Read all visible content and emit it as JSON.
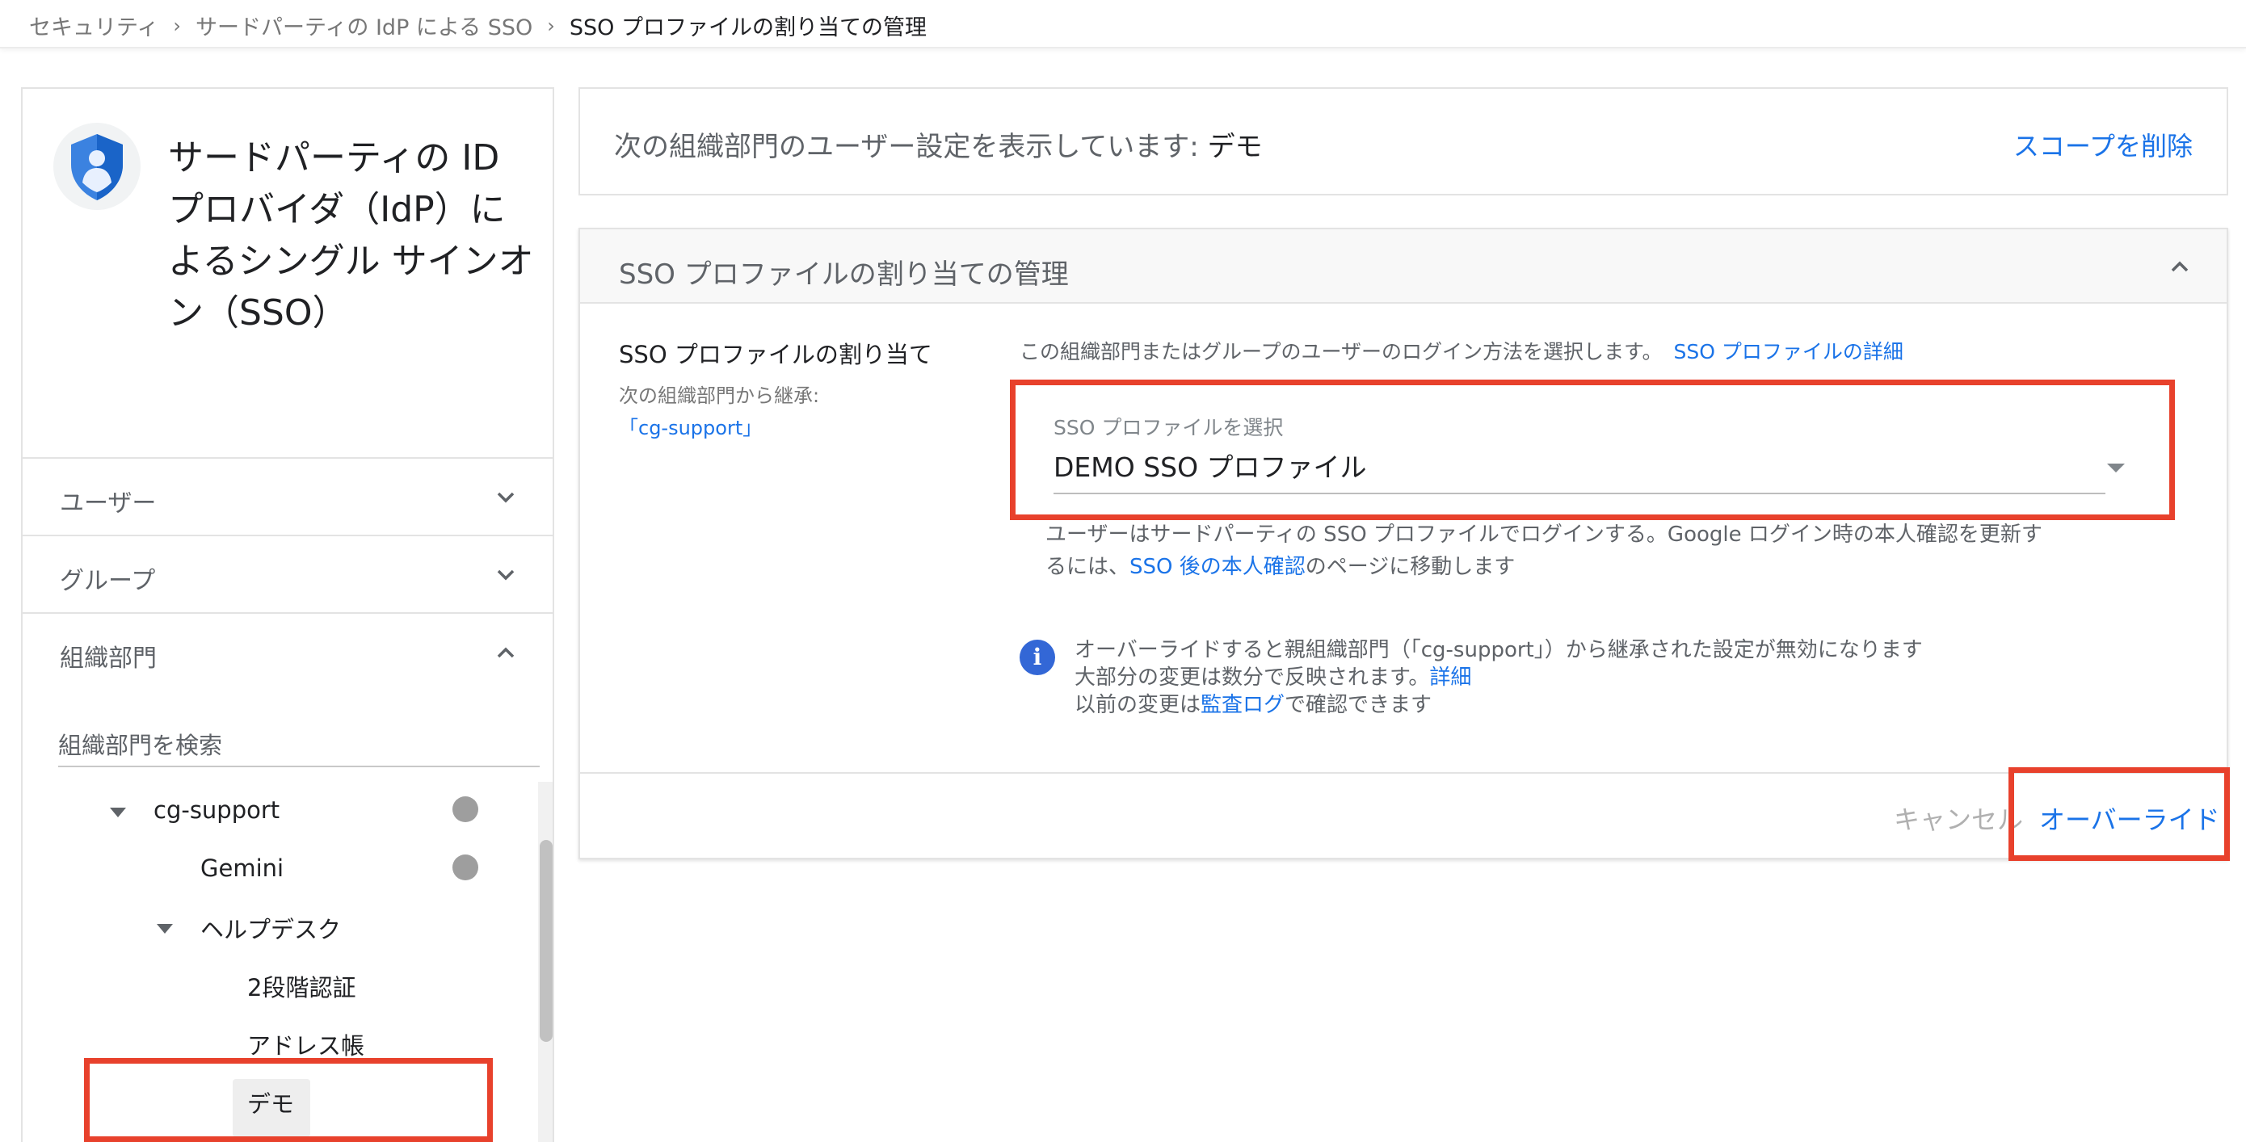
{
  "breadcrumb": {
    "items": [
      "セキュリティ",
      "サードパーティの IdP による SSO"
    ],
    "current": "SSO プロファイルの割り当ての管理"
  },
  "sidebar": {
    "title": "サードパーティの ID プロバイダ（IdP）によるシングル サインオン（SSO）",
    "sections": [
      "ユーザー",
      "グループ",
      "組織部門"
    ],
    "search_label": "組織部門を検索",
    "tree": {
      "root": "cg-support",
      "gemini": "Gemini",
      "helpdesk": "ヘルプデスク",
      "twostep": "2段階認証",
      "addressbook": "アドレス帳",
      "demo": "デモ"
    }
  },
  "scope": {
    "text": "次の組織部門のユーザー設定を表示しています:",
    "org_name": "デモ",
    "remove_link": "スコープを削除"
  },
  "sso": {
    "header": "SSO プロファイルの割り当ての管理",
    "assign_label": "SSO プロファイルの割り当て",
    "inherit_label": "次の組織部門から継承:",
    "inherit_link": "「cg-support」",
    "description": "この組織部門またはグループのユーザーのログイン方法を選択します。",
    "description_link": "SSO プロファイルの詳細",
    "select_label": "SSO プロファイルを選択",
    "select_value": "DEMO SSO プロファイル",
    "help_text_1": "ユーザーはサードパーティの SSO プロファイルでログインする。Google ログイン時の本人確認を更新するには、",
    "help_link": "SSO 後の本人確認",
    "help_text_2": "のページに移動します",
    "info_line1": "オーバーライドすると親組織部門（「cg-support」）から継承された設定が無効になります",
    "info_line2_text": "大部分の変更は数分で反映されます。",
    "info_line2_link": "詳細",
    "info_line3_text": "以前の変更は",
    "info_line3_link": "監査ログ",
    "info_line3_suffix": "で確認できます",
    "cancel": "キャンセル",
    "override": "オーバーライド"
  },
  "colors": {
    "accent": "#1a73e8",
    "highlight": "#e8412c",
    "info": "#3367d6"
  }
}
